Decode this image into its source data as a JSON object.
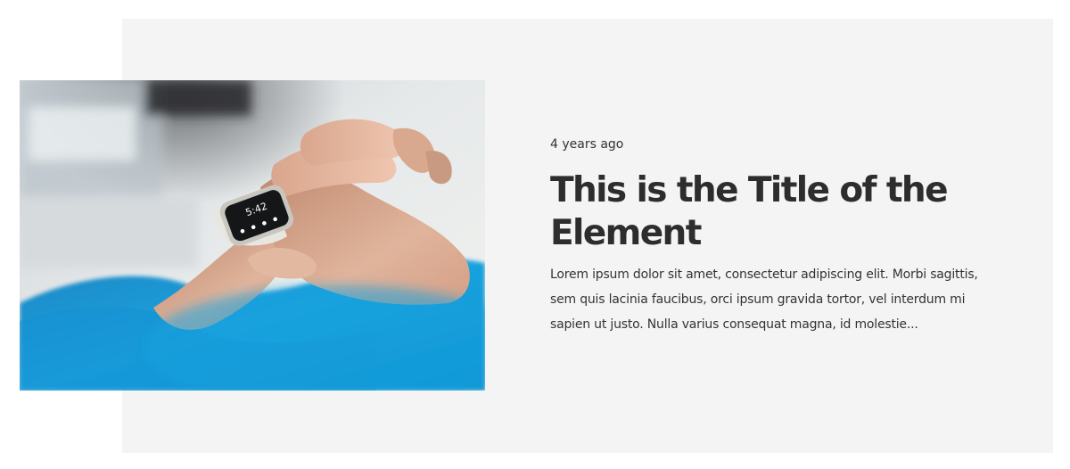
{
  "card": {
    "meta": {
      "date": "4 years ago"
    },
    "title": "This is the Title of the Element",
    "excerpt": "Lorem ipsum dolor sit amet, consectetur adipiscing elit. Morbi sagittis, sem quis lacinia faucibus, orci ipsum gravida tortor, vel interdum mi sapien ut justo. Nulla varius consequat magna, id molestie...",
    "image": {
      "watch_time": "5:42",
      "icon": "smartwatch-photo"
    },
    "colors": {
      "panel_background": "#f4f4f4",
      "title": "#2d2d2d",
      "body_text": "#333333",
      "sleeve_blue": "#1a9fdc"
    }
  }
}
